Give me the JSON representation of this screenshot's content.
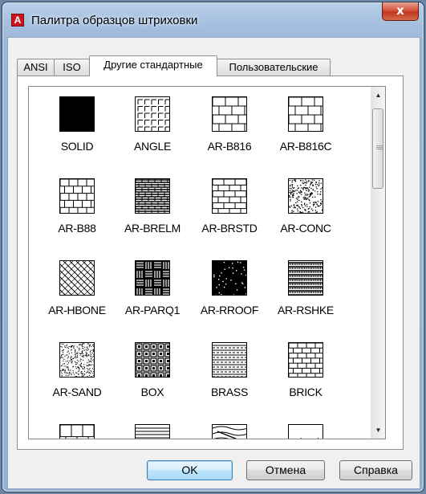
{
  "window": {
    "title": "Палитра образцов штриховки",
    "app_icon_letter": "A",
    "close_glyph": "x"
  },
  "tabs": [
    {
      "label": "ANSI",
      "active": false
    },
    {
      "label": "ISO",
      "active": false
    },
    {
      "label": "Другие стандартные",
      "active": true
    },
    {
      "label": "Пользовательские",
      "active": false
    }
  ],
  "patterns": [
    {
      "name": "SOLID",
      "icon": "solid-fill"
    },
    {
      "name": "ANGLE",
      "icon": "angle-grid"
    },
    {
      "name": "AR-B816",
      "icon": "brick-large"
    },
    {
      "name": "AR-B816C",
      "icon": "brick-large"
    },
    {
      "name": "AR-B88",
      "icon": "brick-small"
    },
    {
      "name": "AR-BRELM",
      "icon": "brick-dense"
    },
    {
      "name": "AR-BRSTD",
      "icon": "brick-standard"
    },
    {
      "name": "AR-CONC",
      "icon": "concrete-dots"
    },
    {
      "name": "AR-HBONE",
      "icon": "herringbone"
    },
    {
      "name": "AR-PARQ1",
      "icon": "parquet"
    },
    {
      "name": "AR-RROOF",
      "icon": "roof-dots"
    },
    {
      "name": "AR-RSHKE",
      "icon": "shake"
    },
    {
      "name": "AR-SAND",
      "icon": "sand-dots"
    },
    {
      "name": "BOX",
      "icon": "box"
    },
    {
      "name": "BRASS",
      "icon": "brass"
    },
    {
      "name": "BRICK",
      "icon": "brick"
    },
    {
      "name": "",
      "icon": "partial-brick"
    },
    {
      "name": "",
      "icon": "partial-lines"
    },
    {
      "name": "",
      "icon": "partial-wave"
    },
    {
      "name": "",
      "icon": "partial-dots"
    }
  ],
  "buttons": {
    "ok": "OK",
    "cancel": "Отмена",
    "help": "Справка"
  }
}
